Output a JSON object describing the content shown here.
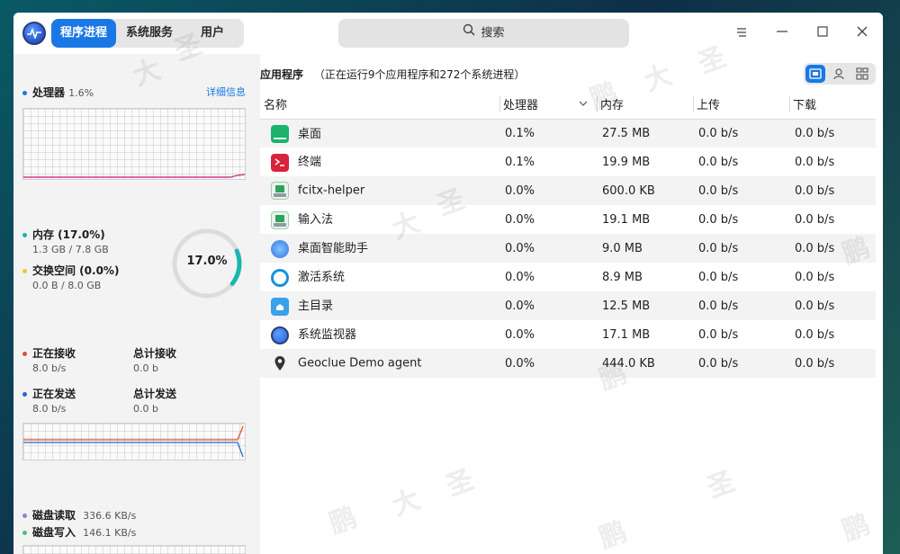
{
  "tabs": [
    {
      "label": "程序进程"
    },
    {
      "label": "系统服务"
    },
    {
      "label": "用户"
    }
  ],
  "search": {
    "label": "搜索"
  },
  "sidebar": {
    "cpu": {
      "label": "处理器",
      "value": "1.6%",
      "link": "详细信息"
    },
    "memory": {
      "label": "内存 (17.0%)",
      "value": "1.3 GB / 7.8 GB",
      "ring_text": "17.0%",
      "percent": 17.0
    },
    "swap": {
      "label": "交换空间 (0.0%)",
      "value": "0.0 B / 8.0 GB"
    },
    "net": {
      "recv_label": "正在接收",
      "recv_value": "8.0 b/s",
      "total_recv_label": "总计接收",
      "total_recv_value": "0.0 b",
      "send_label": "正在发送",
      "send_value": "8.0 b/s",
      "total_send_label": "总计发送",
      "total_send_value": "0.0 b"
    },
    "disk": {
      "read_label": "磁盘读取",
      "read_value": "336.6 KB/s",
      "write_label": "磁盘写入",
      "write_value": "146.1 KB/s"
    }
  },
  "main": {
    "title": "应用程序",
    "subtitle": "（正在运行9个应用程序和272个系统进程）",
    "columns": [
      "名称",
      "处理器",
      "内存",
      "上传",
      "下载"
    ],
    "rows": [
      {
        "name": "桌面",
        "cpu": "0.1%",
        "mem": "27.5 MB",
        "up": "0.0 b/s",
        "down": "0.0 b/s",
        "icon": "desktop-icon"
      },
      {
        "name": "终端",
        "cpu": "0.1%",
        "mem": "19.9 MB",
        "up": "0.0 b/s",
        "down": "0.0 b/s",
        "icon": "terminal-icon"
      },
      {
        "name": "fcitx-helper",
        "cpu": "0.0%",
        "mem": "600.0 KB",
        "up": "0.0 b/s",
        "down": "0.0 b/s",
        "icon": "keyboard-icon"
      },
      {
        "name": "输入法",
        "cpu": "0.0%",
        "mem": "19.1 MB",
        "up": "0.0 b/s",
        "down": "0.0 b/s",
        "icon": "keyboard-icon"
      },
      {
        "name": "桌面智能助手",
        "cpu": "0.0%",
        "mem": "9.0 MB",
        "up": "0.0 b/s",
        "down": "0.0 b/s",
        "icon": "assistant-icon"
      },
      {
        "name": "激活系统",
        "cpu": "0.0%",
        "mem": "8.9 MB",
        "up": "0.0 b/s",
        "down": "0.0 b/s",
        "icon": "activation-icon"
      },
      {
        "name": "主目录",
        "cpu": "0.0%",
        "mem": "12.5 MB",
        "up": "0.0 b/s",
        "down": "0.0 b/s",
        "icon": "home-folder-icon"
      },
      {
        "name": "系统监视器",
        "cpu": "0.0%",
        "mem": "17.1 MB",
        "up": "0.0 b/s",
        "down": "0.0 b/s",
        "icon": "monitor-icon"
      },
      {
        "name": "Geoclue Demo agent",
        "cpu": "0.0%",
        "mem": "444.0 KB",
        "up": "0.0 b/s",
        "down": "0.0 b/s",
        "icon": "location-pin-icon"
      }
    ]
  },
  "colors": {
    "accent": "#1a78e6",
    "mem_ring": "#1bb6b0",
    "recv": "#e0522b",
    "send": "#2a64d8",
    "disk_read": "#9a7bd6",
    "disk_write": "#4fc07a",
    "swap": "#f0c53a"
  }
}
